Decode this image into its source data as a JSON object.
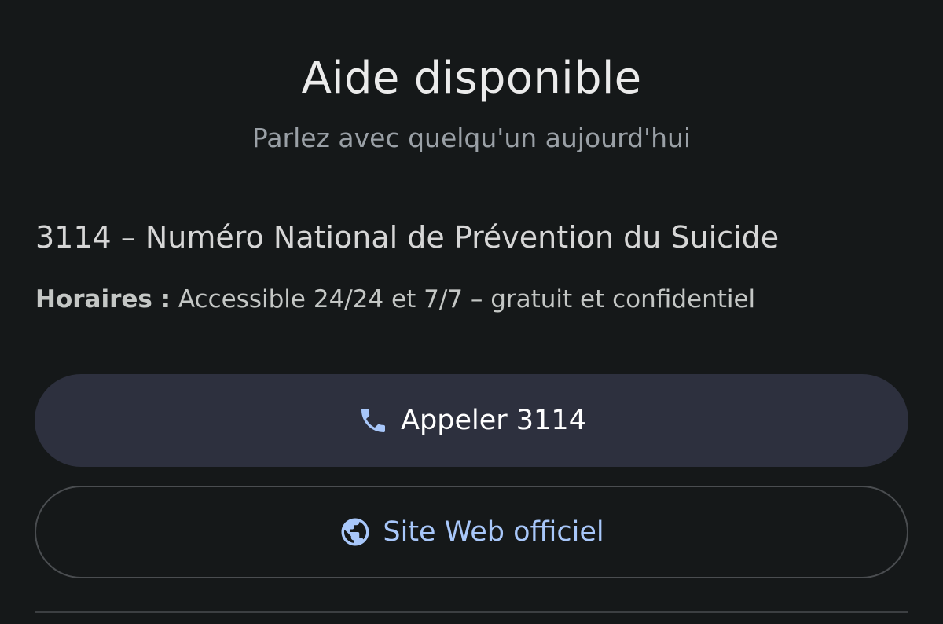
{
  "header": {
    "title": "Aide disponible",
    "subtitle": "Parlez avec quelqu'un aujourd'hui"
  },
  "service": {
    "name": "3114 – Numéro National de Prévention du Suicide",
    "hours_label": "Horaires :",
    "hours_value": "Accessible 24/24 et 7/7 – gratuit et confidentiel"
  },
  "actions": {
    "call": {
      "label": "Appeler 3114",
      "icon": "phone-icon"
    },
    "website": {
      "label": "Site Web officiel",
      "icon": "globe-icon"
    }
  },
  "colors": {
    "background": "#151819",
    "call_button_bg": "#2d303e",
    "accent_blue": "#a8c7fa",
    "outline": "#4a4d50"
  }
}
